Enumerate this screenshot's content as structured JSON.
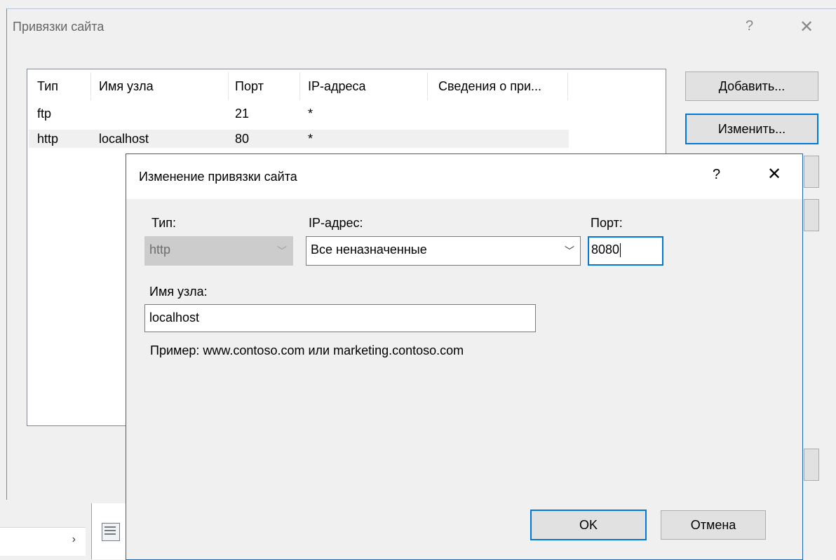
{
  "outer_dialog": {
    "title": "Привязки сайта",
    "help_glyph": "?",
    "close_glyph": "✕",
    "columns": [
      "Тип",
      "Имя узла",
      "Порт",
      "IP-адреса",
      "Сведения о при..."
    ],
    "rows": [
      {
        "type": "ftp",
        "host": "",
        "port": "21",
        "ip": "*"
      },
      {
        "type": "http",
        "host": "localhost",
        "port": "80",
        "ip": "*"
      }
    ],
    "buttons": {
      "add": "Добавить...",
      "edit": "Изменить..."
    }
  },
  "inner_dialog": {
    "title": "Изменение привязки сайта",
    "help_glyph": "?",
    "close_glyph": "✕",
    "type_label": "Тип:",
    "type_value": "http",
    "ip_label": "IP-адрес:",
    "ip_value": "Все неназначенные",
    "port_label": "Порт:",
    "port_value": "8080",
    "host_label": "Имя узла:",
    "host_value": "localhost",
    "example": "Пример: www.contoso.com или marketing.contoso.com",
    "ok": "OK",
    "cancel": "Отмена"
  },
  "background": {
    "nav_chevron": "›"
  },
  "colors": {
    "accent": "#0078d7",
    "selected_row": "#f0f0f0",
    "disabled_field": "#cccccc"
  }
}
